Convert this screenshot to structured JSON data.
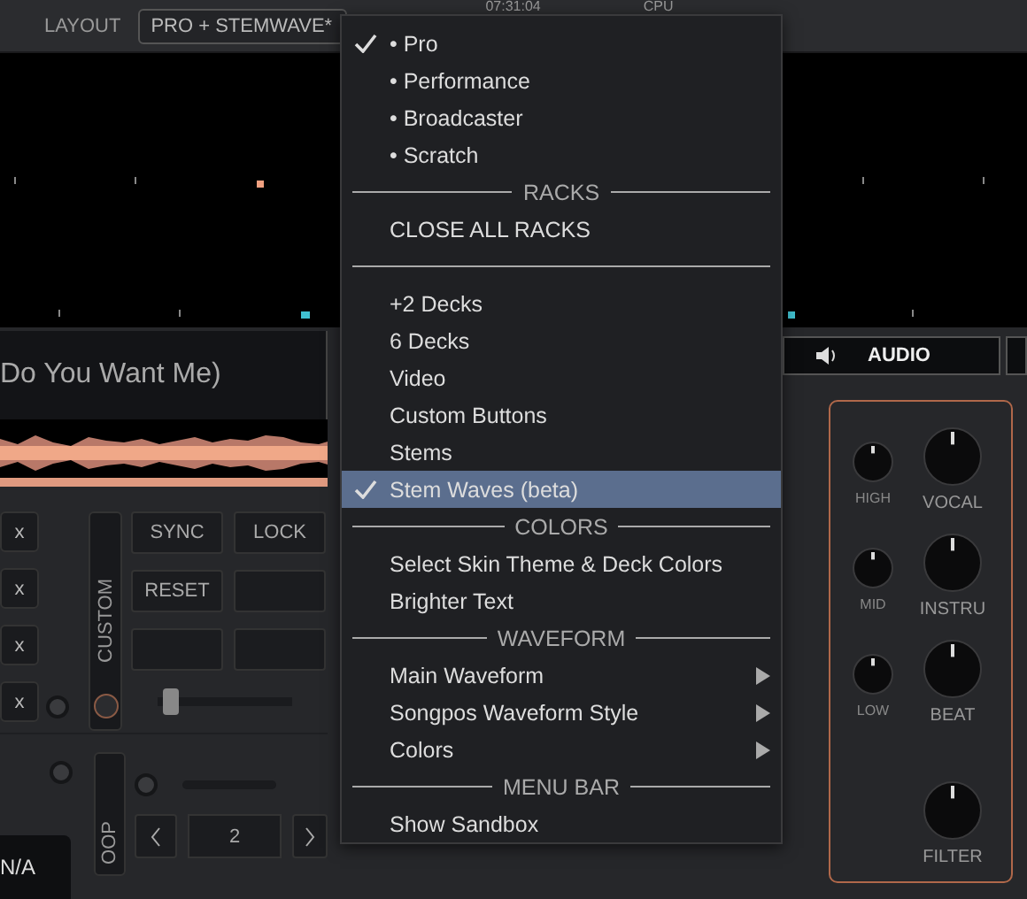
{
  "top_bar": {
    "layout_label": "LAYOUT",
    "layout_value": "PRO + STEMWAVE*",
    "clock": "07:31:04",
    "cpu_label": "CPU"
  },
  "deck": {
    "title": "Do You Want Me)",
    "cue_delete_buttons": [
      "x",
      "x",
      "x",
      "x"
    ],
    "custom_label": "CUSTOM",
    "pads": [
      {
        "label": "SYNC"
      },
      {
        "label": "LOCK"
      },
      {
        "label": "RESET"
      }
    ],
    "slider": {
      "level": 0.05
    },
    "key_value": "N/A",
    "loop_label": "OOP",
    "loop_size": "2"
  },
  "mixer": {
    "tab": "AUDIO",
    "eq_labels": [
      "HIGH",
      "MID",
      "LOW"
    ],
    "stem_labels": [
      "VOCAL",
      "INSTRU",
      "BEAT",
      "FILTER"
    ]
  },
  "menu": {
    "items": [
      {
        "kind": "item",
        "label": "• Pro",
        "checked": true,
        "selected": false,
        "submenu": false
      },
      {
        "kind": "item",
        "label": "• Performance",
        "checked": false,
        "selected": false,
        "submenu": false
      },
      {
        "kind": "item",
        "label": "• Broadcaster",
        "checked": false,
        "selected": false,
        "submenu": false
      },
      {
        "kind": "item",
        "label": "• Scratch",
        "checked": false,
        "selected": false,
        "submenu": false
      },
      {
        "kind": "header",
        "label": "RACKS"
      },
      {
        "kind": "item",
        "label": "CLOSE ALL RACKS",
        "checked": false,
        "selected": false,
        "submenu": false
      },
      {
        "kind": "separator"
      },
      {
        "kind": "item",
        "label": "+2 Decks",
        "checked": false,
        "selected": false,
        "submenu": false
      },
      {
        "kind": "item",
        "label": "6 Decks",
        "checked": false,
        "selected": false,
        "submenu": false
      },
      {
        "kind": "item",
        "label": "Video",
        "checked": false,
        "selected": false,
        "submenu": false
      },
      {
        "kind": "item",
        "label": "Custom Buttons",
        "checked": false,
        "selected": false,
        "submenu": false
      },
      {
        "kind": "item",
        "label": "Stems",
        "checked": false,
        "selected": false,
        "submenu": false
      },
      {
        "kind": "item",
        "label": "Stem Waves (beta)",
        "checked": true,
        "selected": true,
        "submenu": false
      },
      {
        "kind": "header",
        "label": "COLORS"
      },
      {
        "kind": "item",
        "label": "Select Skin Theme & Deck Colors",
        "checked": false,
        "selected": false,
        "submenu": false
      },
      {
        "kind": "item",
        "label": "Brighter Text",
        "checked": false,
        "selected": false,
        "submenu": false
      },
      {
        "kind": "header",
        "label": "WAVEFORM"
      },
      {
        "kind": "item",
        "label": "Main Waveform",
        "checked": false,
        "selected": false,
        "submenu": true
      },
      {
        "kind": "item",
        "label": "Songpos Waveform Style",
        "checked": false,
        "selected": false,
        "submenu": true
      },
      {
        "kind": "item",
        "label": "Colors",
        "checked": false,
        "selected": false,
        "submenu": true
      },
      {
        "kind": "header",
        "label": "MENU BAR"
      },
      {
        "kind": "item",
        "label": "Show Sandbox",
        "checked": false,
        "selected": false,
        "submenu": false
      }
    ]
  }
}
